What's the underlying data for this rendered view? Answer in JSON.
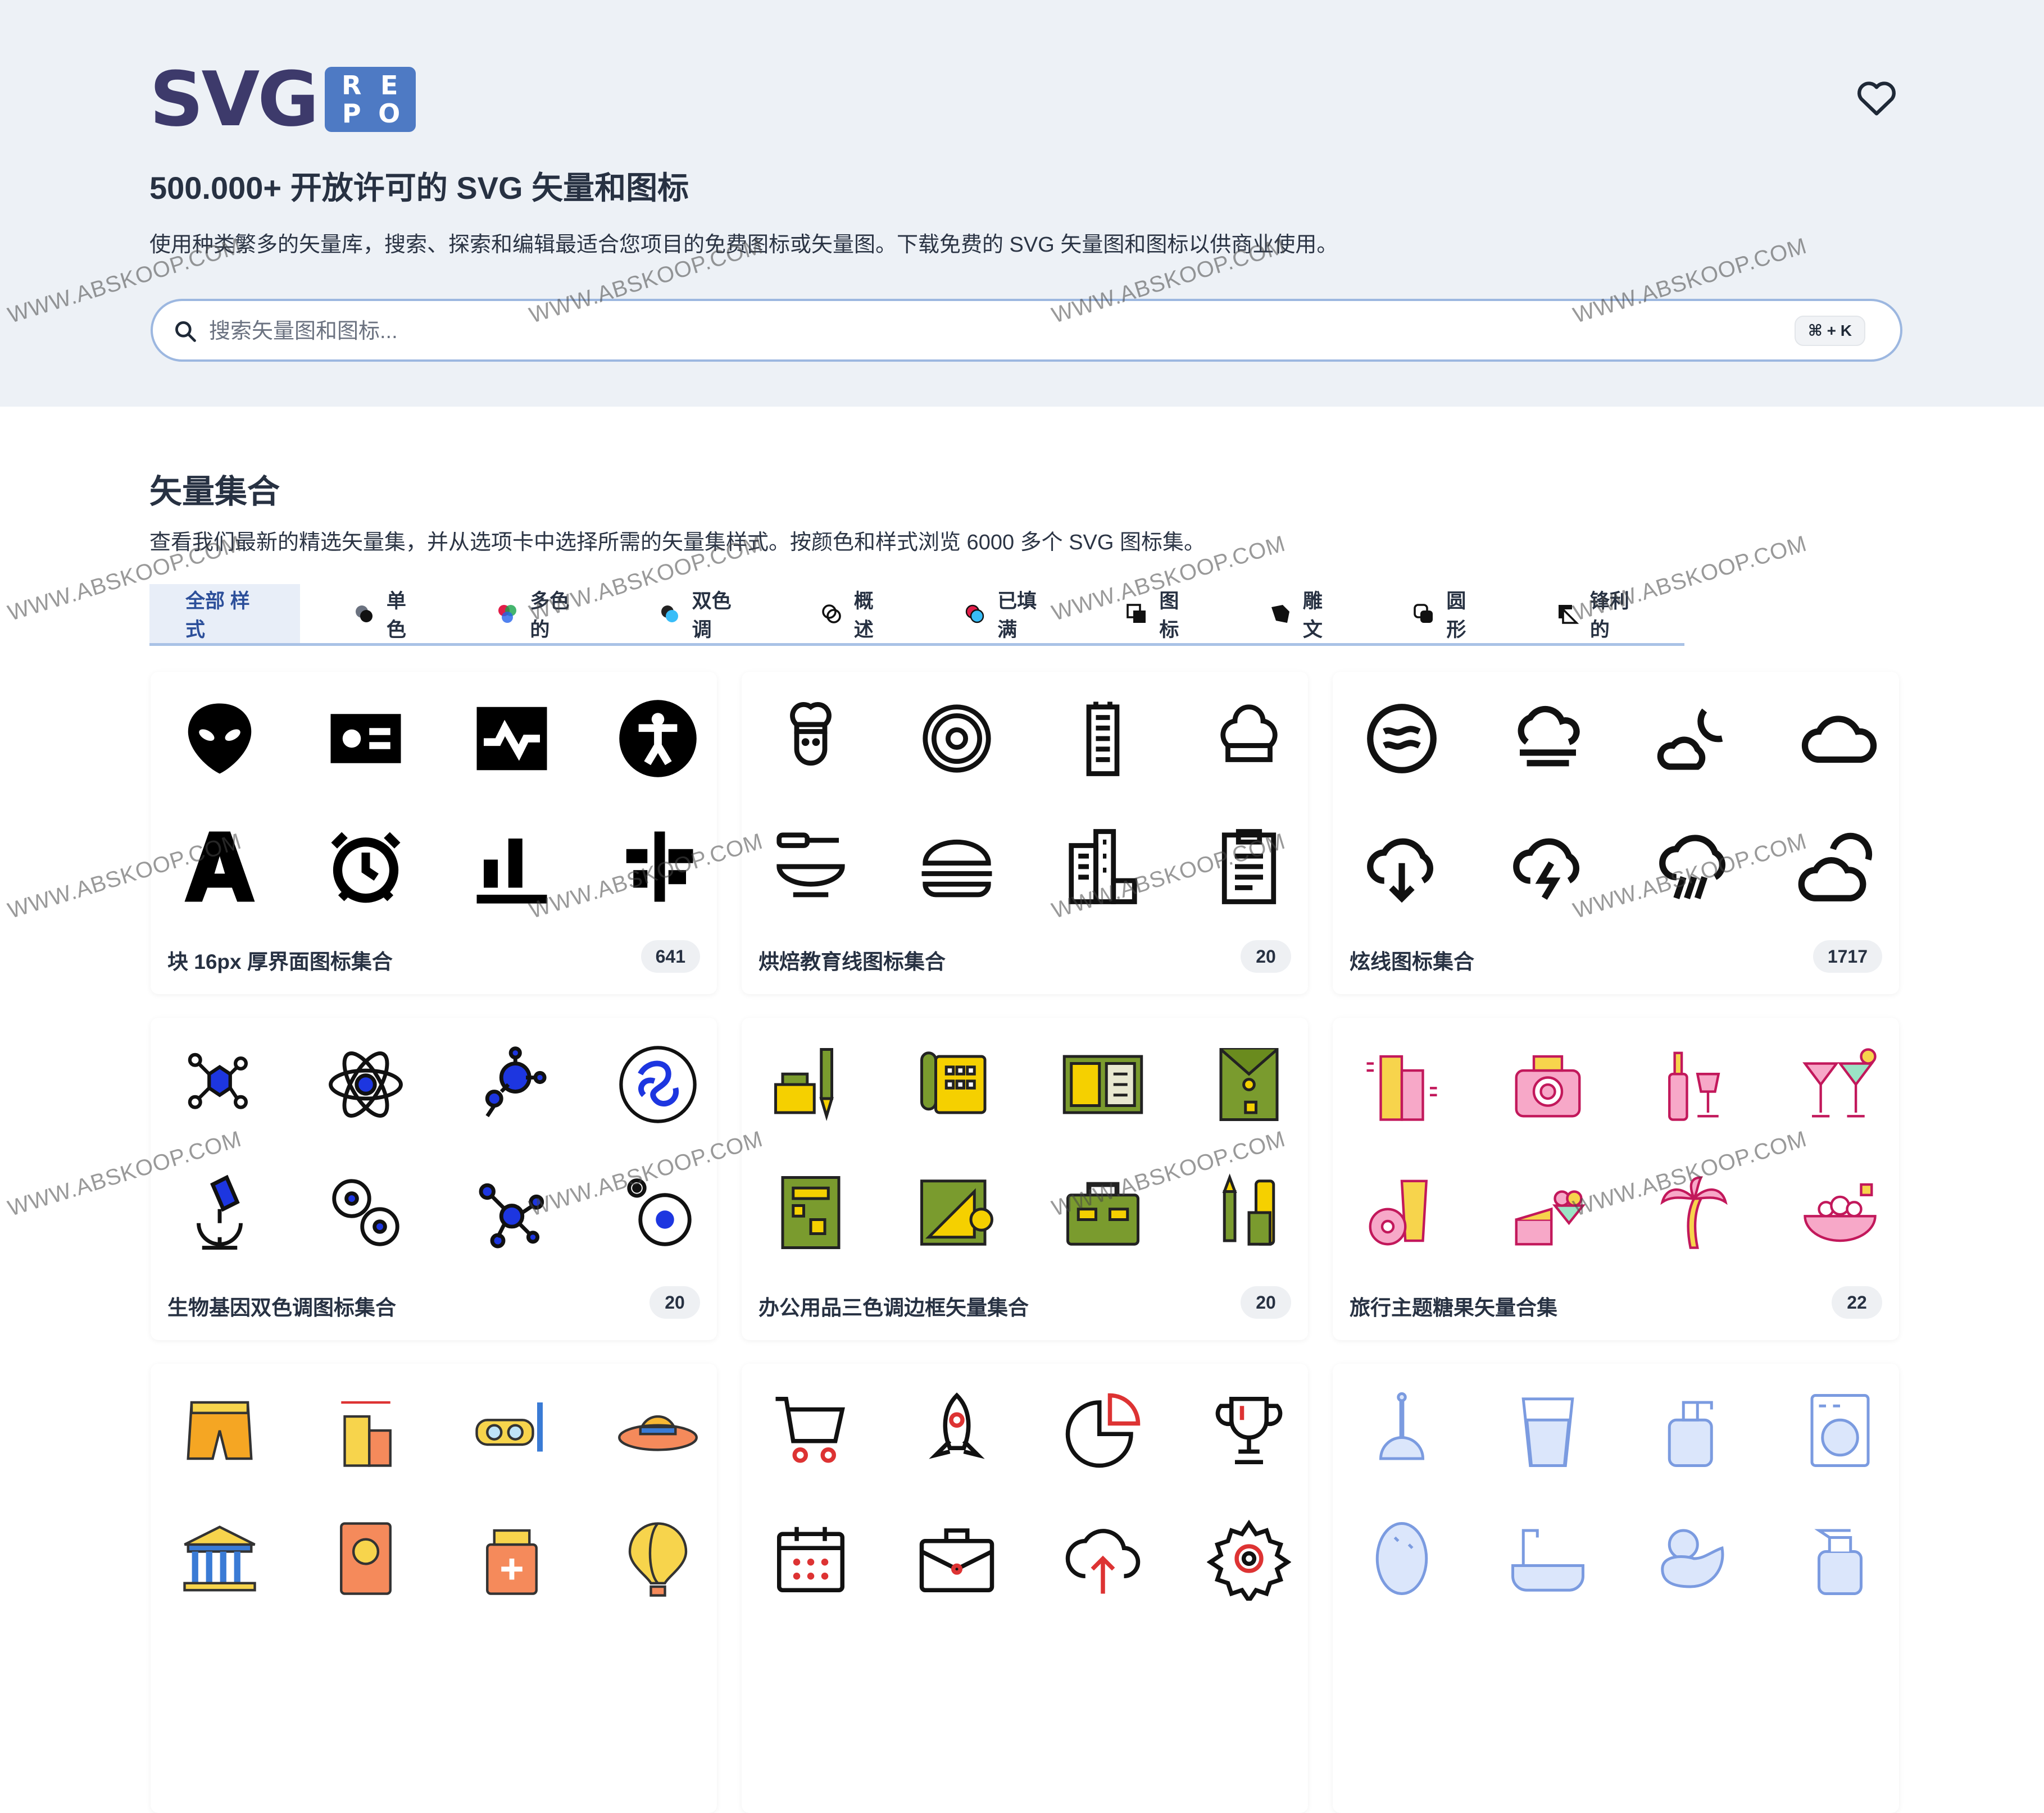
{
  "header": {
    "logo_text": "SVG",
    "logo_box": [
      "R",
      "E",
      "P",
      "O"
    ],
    "title": "500.000+ 开放许可的 SVG 矢量和图标",
    "description": "使用种类繁多的矢量库，搜索、探索和编辑最适合您项目的免费图标或矢量图。下载免费的 SVG 矢量图和图标以供商业使用。",
    "heart_icon": "heart-icon"
  },
  "search": {
    "placeholder": "搜索矢量图和图标...",
    "shortcut": "⌘ + K"
  },
  "section": {
    "title": "矢量集合",
    "description": "查看我们最新的精选矢量集，并从选项卡中选择所需的矢量集样式。按颜色和样式浏览 6000 多个 SVG 图标集。"
  },
  "tabs": [
    {
      "label": "全部 样式",
      "icon": "none",
      "active": true
    },
    {
      "label": "单色",
      "icon": "mono-circles-icon"
    },
    {
      "label": "多色的",
      "icon": "multicolor-circles-icon"
    },
    {
      "label": "双色调",
      "icon": "duotone-circles-icon"
    },
    {
      "label": "概述",
      "icon": "outline-circles-icon"
    },
    {
      "label": "已填满",
      "icon": "filled-circles-icon"
    },
    {
      "label": "图标",
      "icon": "glyph-squares-icon"
    },
    {
      "label": "雕文",
      "icon": "carved-icon"
    },
    {
      "label": "圆形",
      "icon": "rounded-squares-icon"
    },
    {
      "label": "锋利的",
      "icon": "sharp-corner-icon"
    }
  ],
  "collections": [
    {
      "name": "块 16px 厚界面图标集合",
      "count": "641"
    },
    {
      "name": "烘焙教育线图标集合",
      "count": "20"
    },
    {
      "name": "炫线图标集合",
      "count": "1717"
    },
    {
      "name": "生物基因双色调图标集合",
      "count": "20"
    },
    {
      "name": "办公用品三色调边框矢量集合",
      "count": "20"
    },
    {
      "name": "旅行主题糖果矢量合集",
      "count": "22"
    },
    {
      "name": "",
      "count": ""
    },
    {
      "name": "",
      "count": ""
    },
    {
      "name": "",
      "count": ""
    }
  ],
  "watermark": "WWW.ABSKOOP.COM",
  "colors": {
    "accent": "#2c4f9a",
    "hero_bg": "#edf1f6",
    "logo_box": "#4e7ac4",
    "bio_blue": "#1d36e0"
  }
}
